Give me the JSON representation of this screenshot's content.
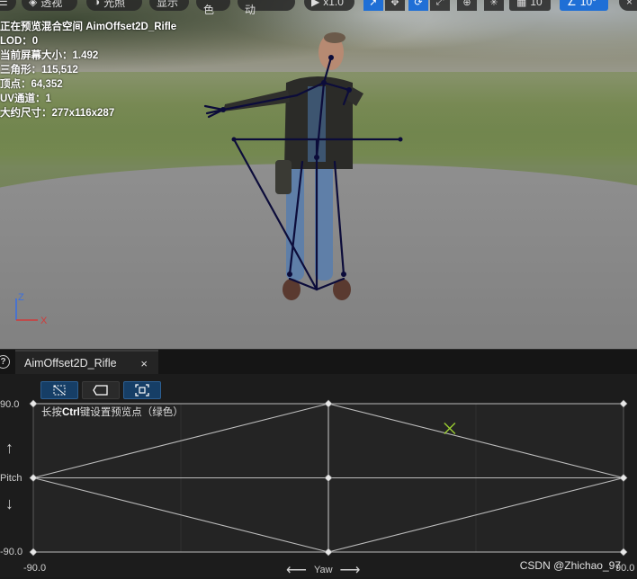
{
  "toolbar": {
    "perspective_label": "透视",
    "lighting_label": "光照",
    "show_label": "显示",
    "character_label": "角色",
    "lod_label": "LOD自动",
    "play_speed_label": "x1.0",
    "grid_snap_value": "10",
    "angle_snap_value": "10°"
  },
  "stats": {
    "line1": "正在预览混合空间 AimOffset2D_Rifle",
    "line2": "LOD：0",
    "line3": "当前屏幕大小：1.492",
    "line4": "三角形：115,512",
    "line5": "顶点：64,352",
    "line6": "UV通道：1",
    "line7": "大约尺寸：277x116x287"
  },
  "axes": {
    "z_label": "Z",
    "x_label": "X"
  },
  "tab": {
    "title": "AimOffset2D_Rifle",
    "close_glyph": "×",
    "help_glyph": "?"
  },
  "blendspace": {
    "hint_prefix": "长按",
    "hint_key": "Ctrl",
    "hint_suffix": "键设置预览点（绿色）",
    "y_max_label": "90.0",
    "y_min_label": "-90.0",
    "y_axis_name": "Pitch",
    "x_min_label": "-90.0",
    "x_max_label": "90.0",
    "x_axis_name": "Yaw",
    "preview_point": {
      "yaw": 37,
      "pitch": 60
    },
    "sample_points": [
      {
        "yaw": -90,
        "pitch": 90
      },
      {
        "yaw": 0,
        "pitch": 90
      },
      {
        "yaw": 90,
        "pitch": 90
      },
      {
        "yaw": -90,
        "pitch": 0
      },
      {
        "yaw": 0,
        "pitch": 0
      },
      {
        "yaw": 90,
        "pitch": 0
      },
      {
        "yaw": -90,
        "pitch": -90
      },
      {
        "yaw": 0,
        "pitch": -90
      },
      {
        "yaw": 90,
        "pitch": -90
      }
    ]
  },
  "watermark": "CSDN @Zhichao_97",
  "colors": {
    "accent": "#1f6fd6",
    "preview_point": "#9acd32",
    "skeleton": "#0c0c3a"
  }
}
